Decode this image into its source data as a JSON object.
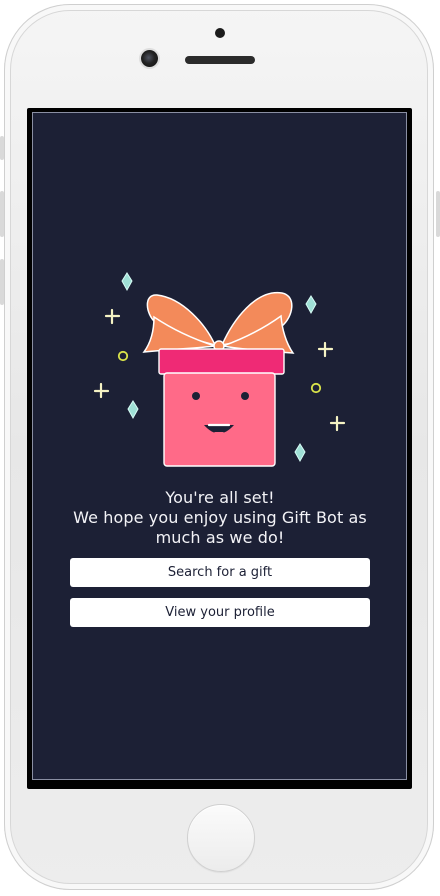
{
  "screen": {
    "headline_line1": "You're all set!",
    "headline_line2": "We hope you enjoy using Gift Bot as",
    "headline_line3": "much as we do!",
    "primary_button_label": "Search for a gift",
    "secondary_button_label": "View your profile"
  },
  "colors": {
    "background": "#1c2035",
    "gift_box": "#ff6a88",
    "gift_lid": "#ef2a75",
    "bow": "#f38a5a",
    "diamond": "#9fe0d6",
    "sparkle": "#f5f3c4"
  },
  "icons": {
    "hero": "gift-box-illustration",
    "device_home": "home-button"
  }
}
